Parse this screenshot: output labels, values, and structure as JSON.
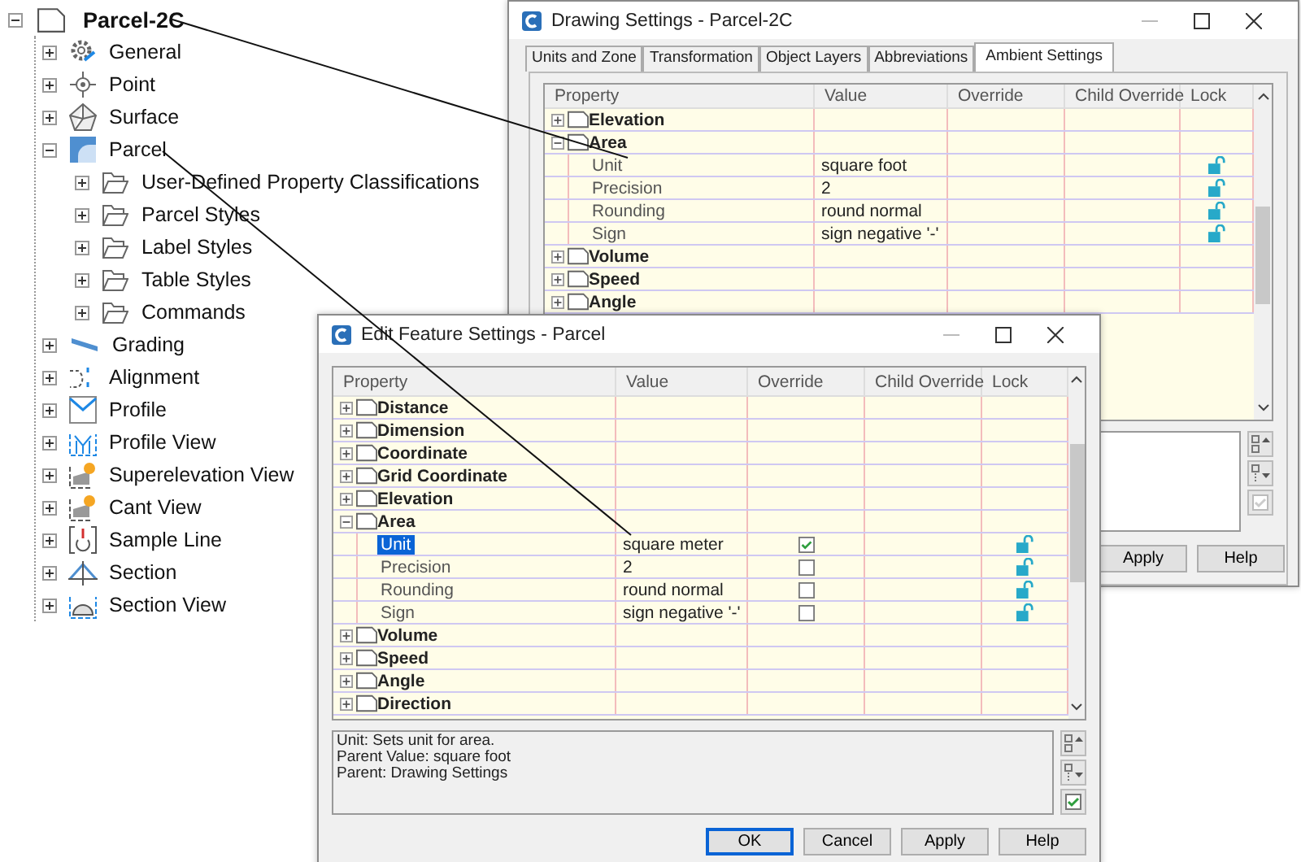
{
  "tree": {
    "label": "Parcel-2C",
    "expanded": true,
    "children": [
      {
        "label": "General",
        "expanded": false
      },
      {
        "label": "Point",
        "expanded": false
      },
      {
        "label": "Surface",
        "expanded": false
      },
      {
        "label": "Parcel",
        "expanded": true,
        "children": [
          {
            "label": "User-Defined Property Classifications",
            "expanded": false
          },
          {
            "label": "Parcel Styles",
            "expanded": false
          },
          {
            "label": "Label Styles",
            "expanded": false
          },
          {
            "label": "Table Styles",
            "expanded": false
          },
          {
            "label": "Commands",
            "expanded": false
          }
        ]
      },
      {
        "label": "Grading",
        "expanded": false
      },
      {
        "label": "Alignment",
        "expanded": false
      },
      {
        "label": "Profile",
        "expanded": false
      },
      {
        "label": "Profile View",
        "expanded": false
      },
      {
        "label": "Superelevation View",
        "expanded": false
      },
      {
        "label": "Cant View",
        "expanded": false
      },
      {
        "label": "Sample Line",
        "expanded": false
      },
      {
        "label": "Section",
        "expanded": false
      },
      {
        "label": "Section View",
        "expanded": false
      }
    ]
  },
  "windows": [
    {
      "title": "Drawing Settings - Parcel-2C",
      "tabs": [
        {
          "label": "Units and Zone",
          "selected": false
        },
        {
          "label": "Transformation",
          "selected": false
        },
        {
          "label": "Object Layers",
          "selected": false
        },
        {
          "label": "Abbreviations",
          "selected": false
        },
        {
          "label": "Ambient Settings",
          "selected": true
        }
      ],
      "columns": [
        "Property",
        "Value",
        "Override",
        "Child Override",
        "Lock"
      ],
      "rows": [
        {
          "kind": "group",
          "label": "Elevation",
          "expanded": false
        },
        {
          "kind": "group",
          "label": "Area",
          "expanded": true
        },
        {
          "kind": "property",
          "label": "Unit",
          "value": "square foot",
          "locked": false,
          "selected": false
        },
        {
          "kind": "property",
          "label": "Precision",
          "value": "2",
          "locked": false,
          "selected": false
        },
        {
          "kind": "property",
          "label": "Rounding",
          "value": "round normal",
          "locked": false,
          "selected": false
        },
        {
          "kind": "property",
          "label": "Sign",
          "value": "sign negative '-'",
          "locked": false,
          "selected": false
        },
        {
          "kind": "group",
          "label": "Volume",
          "expanded": false
        },
        {
          "kind": "group",
          "label": "Speed",
          "expanded": false
        },
        {
          "kind": "group",
          "label": "Angle",
          "expanded": false
        }
      ],
      "check_button": {
        "disabled": true
      },
      "buttons": [
        {
          "label": "Apply",
          "default": false
        },
        {
          "label": "Help",
          "default": false
        }
      ]
    },
    {
      "title": "Edit Feature Settings - Parcel",
      "columns": [
        "Property",
        "Value",
        "Override",
        "Child Override",
        "Lock"
      ],
      "rows": [
        {
          "kind": "group",
          "label": "Distance",
          "expanded": false
        },
        {
          "kind": "group",
          "label": "Dimension",
          "expanded": false
        },
        {
          "kind": "group",
          "label": "Coordinate",
          "expanded": false
        },
        {
          "kind": "group",
          "label": "Grid Coordinate",
          "expanded": false
        },
        {
          "kind": "group",
          "label": "Elevation",
          "expanded": false
        },
        {
          "kind": "group",
          "label": "Area",
          "expanded": true
        },
        {
          "kind": "property",
          "label": "Unit",
          "value": "square meter",
          "override": true,
          "locked": false,
          "selected": true
        },
        {
          "kind": "property",
          "label": "Precision",
          "value": "2",
          "override": false,
          "locked": false,
          "selected": false
        },
        {
          "kind": "property",
          "label": "Rounding",
          "value": "round normal",
          "override": false,
          "locked": false,
          "selected": false
        },
        {
          "kind": "property",
          "label": "Sign",
          "value": "sign negative '-'",
          "override": false,
          "locked": false,
          "selected": false
        },
        {
          "kind": "group",
          "label": "Volume",
          "expanded": false
        },
        {
          "kind": "group",
          "label": "Speed",
          "expanded": false
        },
        {
          "kind": "group",
          "label": "Angle",
          "expanded": false
        },
        {
          "kind": "group",
          "label": "Direction",
          "expanded": false
        }
      ],
      "description": [
        "Unit: Sets unit for area.",
        "Parent Value: square foot",
        "Parent: Drawing Settings"
      ],
      "check_button": {
        "disabled": false
      },
      "buttons": [
        {
          "label": "OK",
          "default": true
        },
        {
          "label": "Cancel",
          "default": false
        },
        {
          "label": "Apply",
          "default": false
        },
        {
          "label": "Help",
          "default": false
        }
      ]
    }
  ]
}
